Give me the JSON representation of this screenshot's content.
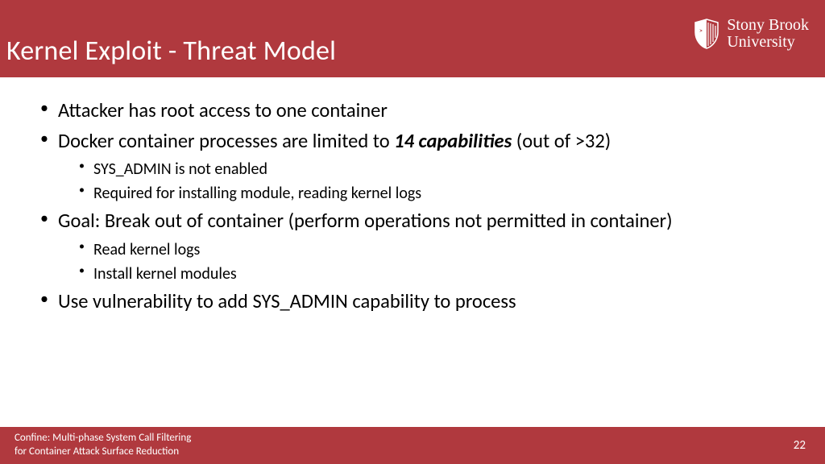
{
  "header": {
    "title": "Kernel Exploit - Threat Model",
    "logo_line1": "Stony Brook",
    "logo_line2": "University"
  },
  "body": {
    "b1": "Attacker has root access to one container",
    "b2_pre": "Docker container processes are limited to ",
    "b2_bold": "14 capabilities",
    "b2_post": " (out of >32)",
    "b2_sub1": "SYS_ADMIN is not enabled",
    "b2_sub2": "Required for installing module, reading kernel logs",
    "b3": "Goal: Break out of container (perform operations not permitted in container)",
    "b3_sub1": "Read kernel logs",
    "b3_sub2": "Install kernel modules",
    "b4": "Use vulnerability to add SYS_ADMIN capability to process"
  },
  "footer": {
    "line1": "Confine: Multi-phase System Call Filtering",
    "line2": "for Container Attack Surface Reduction",
    "page": "22"
  },
  "colors": {
    "brand": "#b0393e"
  }
}
